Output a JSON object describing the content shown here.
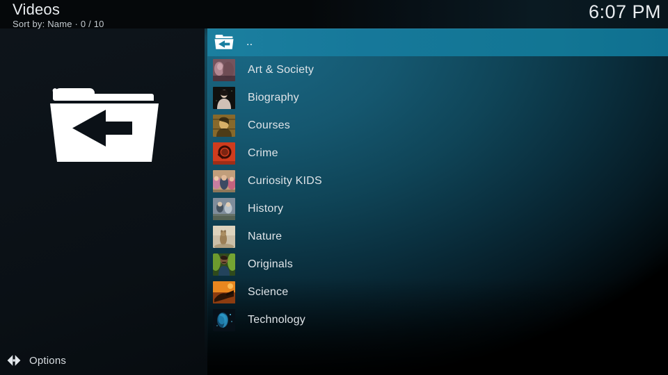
{
  "header": {
    "title": "Videos",
    "sort_line": "Sort by: Name  ·  0 / 10",
    "clock": "6:07 PM"
  },
  "preview": {
    "icon": "folder-back-icon"
  },
  "footer": {
    "options_label": "Options",
    "options_icon": "left-right-arrows-icon"
  },
  "colors": {
    "highlight": "#16789a",
    "panel_dark": "#0c1218",
    "text": "#dfe4e8"
  },
  "list": {
    "selected_index": 0,
    "items": [
      {
        "label": "..",
        "icon": "folder-back-icon",
        "type": "parent"
      },
      {
        "label": "Art & Society",
        "type": "folder",
        "thumb": "art-society-thumb"
      },
      {
        "label": "Biography",
        "type": "folder",
        "thumb": "biography-thumb"
      },
      {
        "label": "Courses",
        "type": "folder",
        "thumb": "courses-thumb"
      },
      {
        "label": "Crime",
        "type": "folder",
        "thumb": "crime-thumb"
      },
      {
        "label": "Curiosity KIDS",
        "type": "folder",
        "thumb": "curiosity-kids-thumb"
      },
      {
        "label": "History",
        "type": "folder",
        "thumb": "history-thumb"
      },
      {
        "label": "Nature",
        "type": "folder",
        "thumb": "nature-thumb"
      },
      {
        "label": "Originals",
        "type": "folder",
        "thumb": "originals-thumb"
      },
      {
        "label": "Science",
        "type": "folder",
        "thumb": "science-thumb"
      },
      {
        "label": "Technology",
        "type": "folder",
        "thumb": "technology-thumb"
      }
    ]
  }
}
